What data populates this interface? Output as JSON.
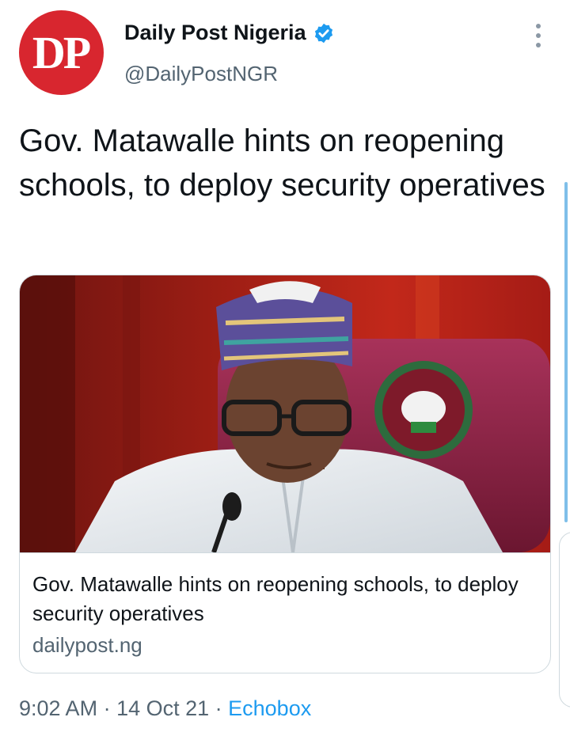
{
  "account": {
    "avatar_text": "DP",
    "display_name": "Daily Post Nigeria",
    "handle": "@DailyPostNGR",
    "verified": true,
    "avatar_color": "#d8262f"
  },
  "tweet": {
    "text": "Gov. Matawalle hints on reopening schools, to deploy security operatives"
  },
  "card": {
    "title": "Gov. Matawalle hints on reopening schools, to deploy security operatives",
    "domain": "dailypost.ng",
    "image_icon": "news-photo-image"
  },
  "meta": {
    "time": "9:02 AM",
    "separator": " · ",
    "date": "14 Oct 21",
    "source": "Echobox"
  },
  "colors": {
    "accent": "#1d9bf0",
    "text": "#0f1419",
    "secondary": "#536471",
    "border": "#cfd9de"
  }
}
